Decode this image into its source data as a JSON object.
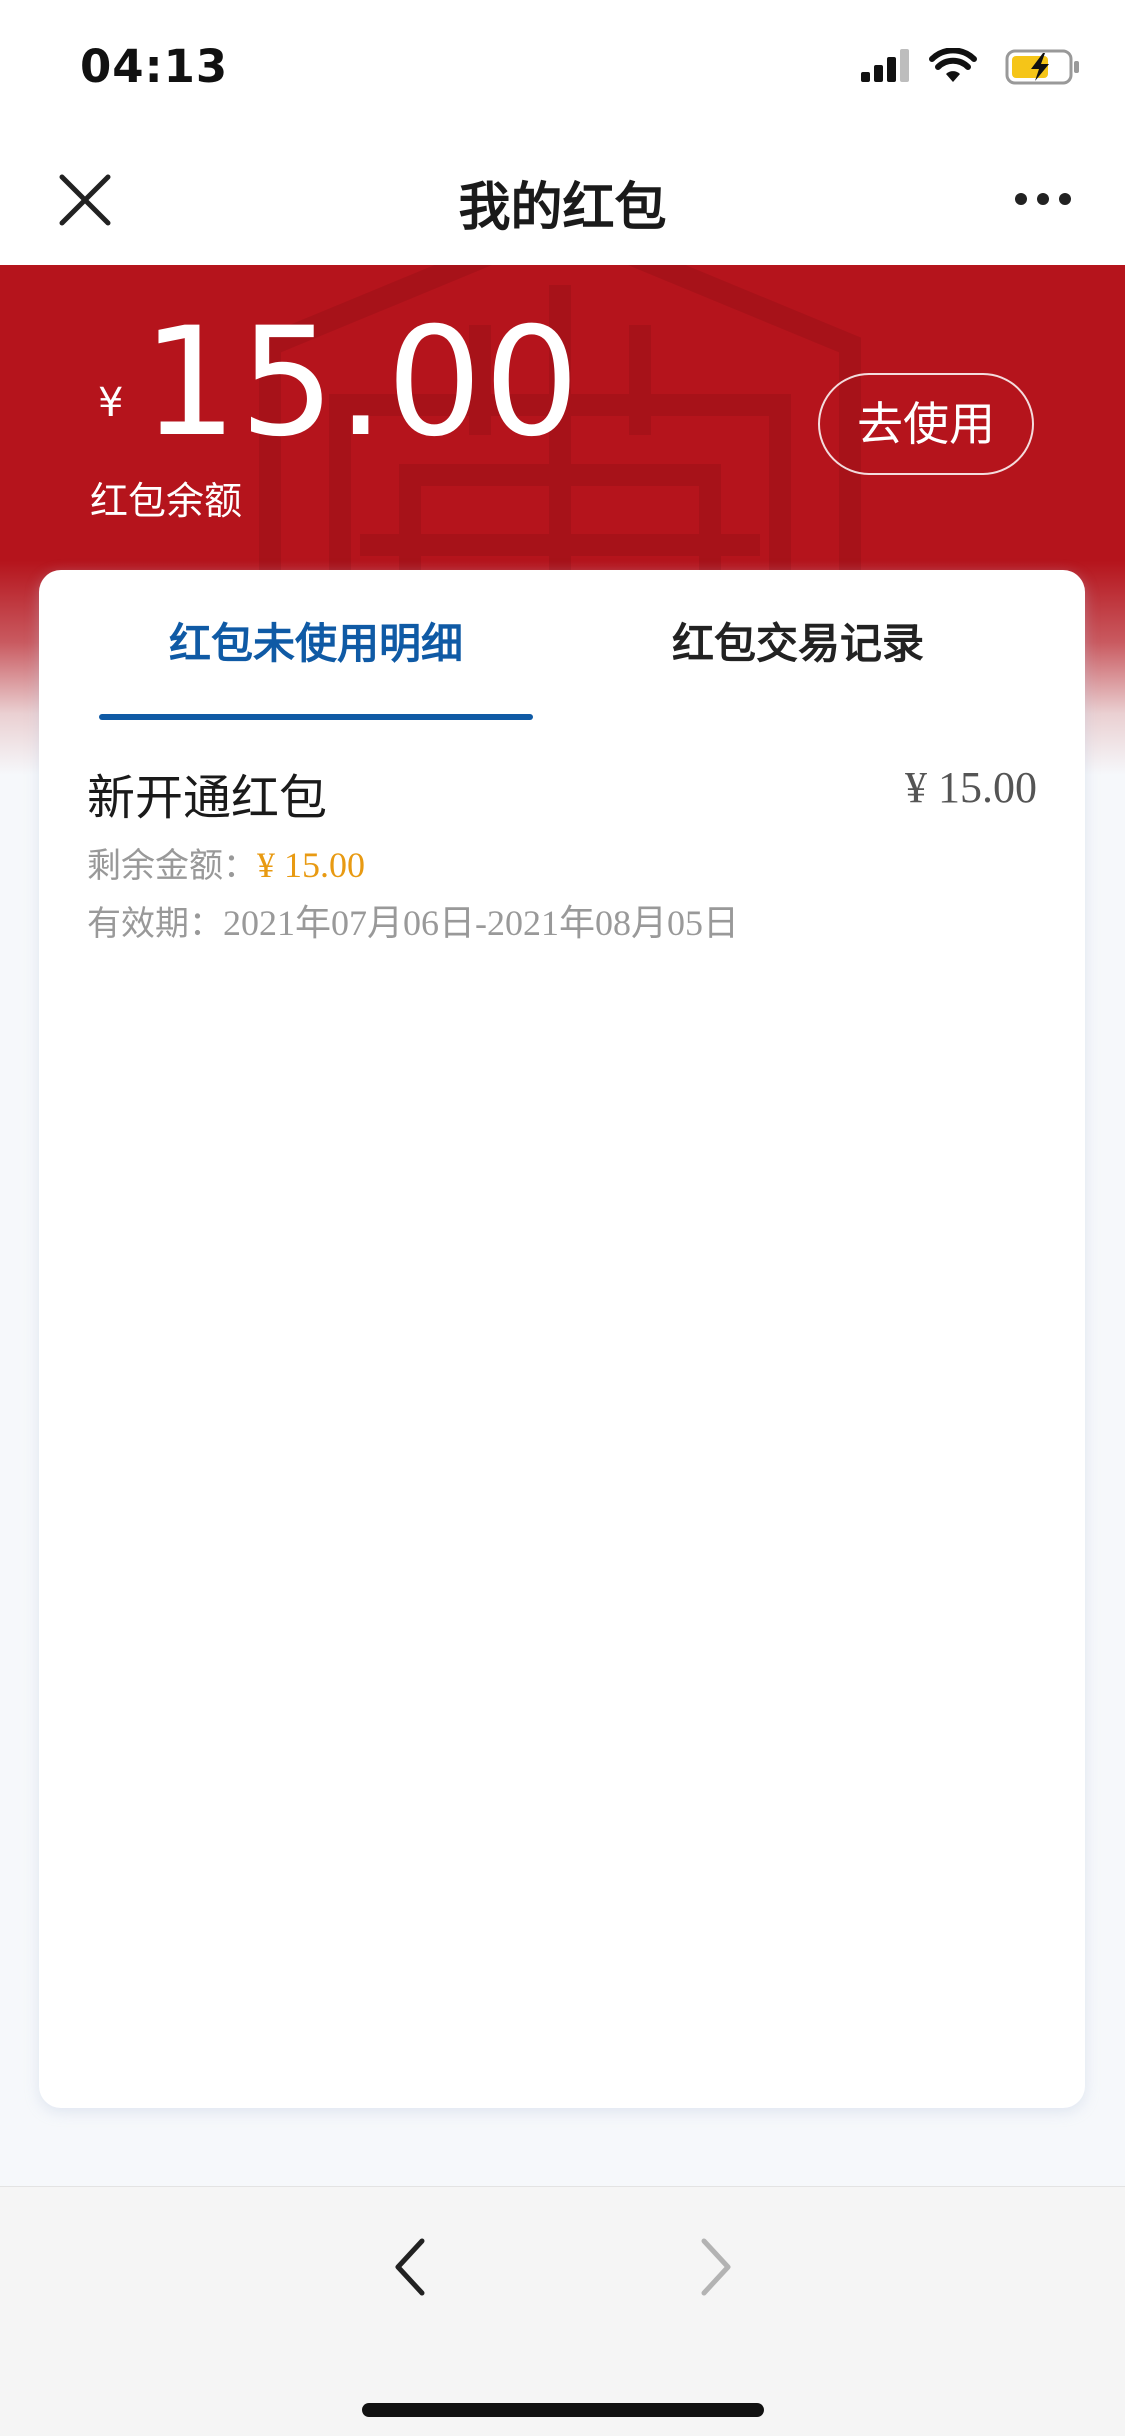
{
  "status_bar": {
    "time": "04:13"
  },
  "nav": {
    "title": "我的红包",
    "close_icon": "close-icon",
    "more_icon": "more-icon"
  },
  "header": {
    "currency_symbol": "¥",
    "balance": "15.00",
    "balance_label": "红包余额",
    "use_button": "去使用"
  },
  "tabs": [
    {
      "label": "红包未使用明细",
      "active": true
    },
    {
      "label": "红包交易记录",
      "active": false
    }
  ],
  "coupons": [
    {
      "title": "新开通红包",
      "amount": "¥ 15.00",
      "remaining_label": "剩余金额：",
      "remaining_value": "¥ 15.00",
      "validity_label": "有效期：",
      "validity_value": "2021年07月06日-2021年08月05日"
    }
  ],
  "colors": {
    "header_red": "#b5141c",
    "active_tab_blue": "#0f5aa5",
    "remaining_orange": "#e89a12",
    "battery_yellow": "#f5c518"
  },
  "toolbar": {
    "back_icon": "chevron-left-icon",
    "forward_icon": "chevron-right-icon"
  }
}
